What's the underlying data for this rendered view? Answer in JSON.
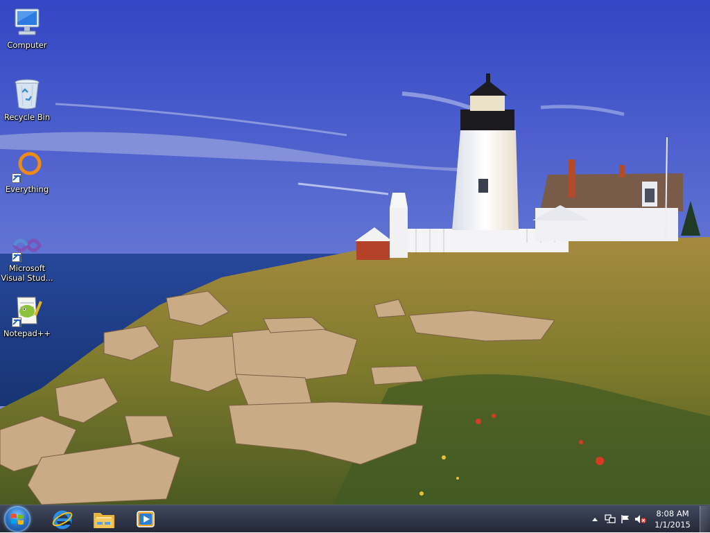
{
  "desktop": {
    "icons": [
      {
        "label": "Computer",
        "icon": "computer-icon"
      },
      {
        "label": "Recycle Bin",
        "icon": "recycle-bin-icon"
      },
      {
        "label": "Everything",
        "icon": "everything-search-icon"
      },
      {
        "label": "Microsoft Visual Stud...",
        "icon": "visual-studio-icon"
      },
      {
        "label": "Notepad++",
        "icon": "notepad-plus-plus-icon"
      }
    ]
  },
  "taskbar": {
    "start": {
      "icon": "windows-start-orb"
    },
    "pinned": [
      {
        "name": "Internet Explorer",
        "icon": "internet-explorer-icon"
      },
      {
        "name": "Windows Explorer",
        "icon": "folder-icon"
      },
      {
        "name": "Windows Media Player",
        "icon": "media-player-icon"
      }
    ],
    "tray": {
      "icons": [
        "show-hidden-icons-arrow",
        "network-icon",
        "action-center-flag-icon",
        "volume-muted-icon"
      ],
      "time": "8:08 AM",
      "date": "1/1/2015"
    }
  },
  "colors": {
    "sky_top": "#3b4fc4",
    "sea": "#1d3f8a",
    "grass": "#8a8a2e",
    "taskbar": "#1e2530"
  }
}
